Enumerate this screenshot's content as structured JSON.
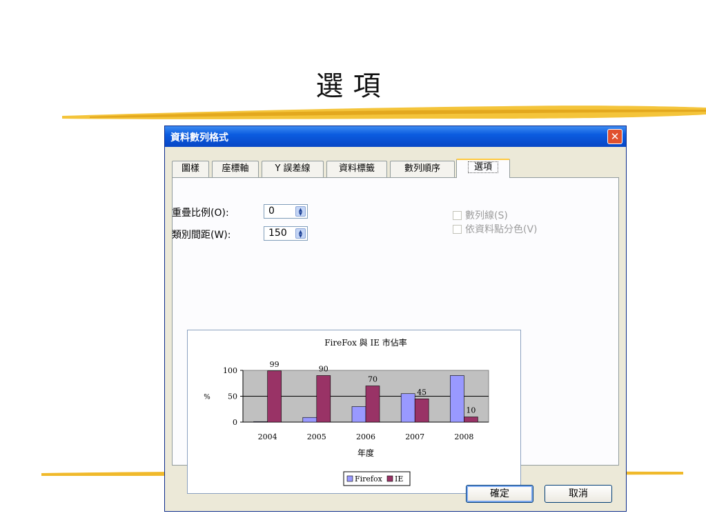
{
  "slide": {
    "title": "選項"
  },
  "dialog": {
    "title": "資料數列格式",
    "close_label": "✕",
    "tabs": [
      {
        "label": "圖樣",
        "active": false
      },
      {
        "label": "座標軸",
        "active": false
      },
      {
        "label": "Y 誤差線",
        "active": false
      },
      {
        "label": "資料標籤",
        "active": false
      },
      {
        "label": "數列順序",
        "active": false
      },
      {
        "label": "選項",
        "active": true
      }
    ],
    "overlap": {
      "label": "重疊比例(O):",
      "value": "0"
    },
    "gap_width": {
      "label": "類別間距(W):",
      "value": "150"
    },
    "options": {
      "series_lines": {
        "label": "數列線(S)",
        "checked": false,
        "enabled": false
      },
      "vary_colors": {
        "label": "依資料點分色(V)",
        "checked": false,
        "enabled": false
      }
    },
    "ok_label": "確定",
    "cancel_label": "取消"
  },
  "colors": {
    "firefox": "#9999ff",
    "ie": "#993366",
    "plot_bg": "#c0c0c0"
  },
  "chart_data": {
    "type": "bar",
    "title": "FireFox 與 IE 市佔率",
    "xlabel": "年度",
    "ylabel": "%",
    "categories": [
      "2004",
      "2005",
      "2006",
      "2007",
      "2008"
    ],
    "series": [
      {
        "name": "Firefox",
        "values": [
          1,
          9,
          30,
          55,
          90
        ],
        "data_labels": [
          "",
          "",
          "",
          "",
          ""
        ]
      },
      {
        "name": "IE",
        "values": [
          99,
          90,
          70,
          45,
          10
        ],
        "data_labels": [
          "99",
          "90",
          "70",
          "45",
          "10"
        ]
      }
    ],
    "yticks": [
      "0",
      "50",
      "100"
    ],
    "ylim": [
      0,
      100
    ],
    "grid": true,
    "legend": "bottom"
  }
}
